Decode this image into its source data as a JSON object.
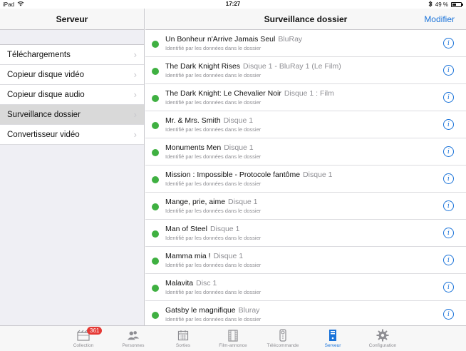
{
  "status_bar": {
    "device": "iPad",
    "time": "17:27",
    "battery": "49 %",
    "battery_level": 0.49
  },
  "master": {
    "title": "Serveur",
    "items": [
      {
        "label": "Téléchargements"
      },
      {
        "label": "Copieur disque vidéo"
      },
      {
        "label": "Copieur disque audio"
      },
      {
        "label": "Surveillance dossier",
        "selected": true
      },
      {
        "label": "Convertisseur vidéo"
      }
    ]
  },
  "detail": {
    "title": "Surveillance dossier",
    "edit_label": "Modifier",
    "rows": [
      {
        "title": "Un Bonheur n'Arrive Jamais Seul",
        "sub": "BluRay",
        "status": "Identifié par les données dans le dossier"
      },
      {
        "title": "The Dark Knight Rises",
        "sub": "Disque 1 - BluRay 1 (Le Film)",
        "status": "Identifié par les données dans le dossier"
      },
      {
        "title": "The Dark Knight: Le Chevalier Noir",
        "sub": "Disque 1 : Film",
        "status": "Identifié par les données dans le dossier"
      },
      {
        "title": "Mr. & Mrs. Smith",
        "sub": "Disque 1",
        "status": "Identifié par les données dans le dossier"
      },
      {
        "title": "Monuments Men",
        "sub": "Disque 1",
        "status": "Identifié par les données dans le dossier"
      },
      {
        "title": "Mission : Impossible - Protocole fantôme",
        "sub": "Disque 1",
        "status": "Identifié par les données dans le dossier"
      },
      {
        "title": "Mange, prie, aime",
        "sub": "Disque 1",
        "status": "Identifié par les données dans le dossier"
      },
      {
        "title": "Man of Steel",
        "sub": "Disque 1",
        "status": "Identifié par les données dans le dossier"
      },
      {
        "title": "Mamma mia !",
        "sub": "Disque 1",
        "status": "Identifié par les données dans le dossier"
      },
      {
        "title": "Malavita",
        "sub": "Disc 1",
        "status": "Identifié par les données dans le dossier"
      },
      {
        "title": "Gatsby le magnifique",
        "sub": "Bluray",
        "status": "Identifié par les données dans le dossier"
      }
    ],
    "info_glyph": "i"
  },
  "tabbar": {
    "tabs": [
      {
        "label": "Collection",
        "icon": "film-icon",
        "badge": "361"
      },
      {
        "label": "Personnes",
        "icon": "people-icon"
      },
      {
        "label": "Sorties",
        "icon": "calendar-icon"
      },
      {
        "label": "Film-annonce",
        "icon": "filmstrip-icon"
      },
      {
        "label": "Télécommande",
        "icon": "remote-icon"
      },
      {
        "label": "Serveur",
        "icon": "server-icon",
        "active": true
      },
      {
        "label": "Configuration",
        "icon": "gear-icon"
      }
    ]
  },
  "colors": {
    "accent": "#1a73d9",
    "status_ok": "#3fb041",
    "badge": "#e53935"
  }
}
